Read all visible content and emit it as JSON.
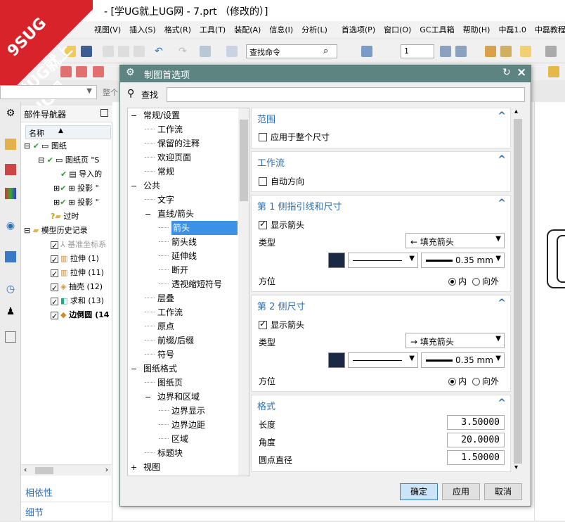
{
  "window": {
    "title": "- [学UG就上UG网 - 7.prt （修改的）]"
  },
  "logo": {
    "line1": "9SUG",
    "line2": "学UG就上UG网"
  },
  "menu": [
    "视图(V)",
    "插入(S)",
    "格式(R)",
    "工具(T)",
    "装配(A)",
    "信息(I)",
    "分析(L)",
    "首选项(P)",
    "窗口(O)",
    "GC工具箱",
    "帮助(H)",
    "中磊1.0",
    "中磊教程"
  ],
  "toolbar": {
    "find_command": "查找命令",
    "layer_value": "1"
  },
  "filter": {
    "value": "整个"
  },
  "navigator": {
    "title": "部件导航器",
    "column": "名称",
    "rows": [
      {
        "label": "图纸"
      },
      {
        "label": "图纸页 \"S"
      },
      {
        "label": "导入的"
      },
      {
        "label": "投影 \""
      },
      {
        "label": "投影 \""
      },
      {
        "label": "过时"
      },
      {
        "label": "模型历史记录"
      },
      {
        "label": "基准坐标系"
      },
      {
        "label": "拉伸 (1)"
      },
      {
        "label": "拉伸 (11)"
      },
      {
        "label": "抽壳 (12)"
      },
      {
        "label": "求和 (13)"
      },
      {
        "label": "边倒圆 (14"
      }
    ],
    "links": [
      "相依性",
      "细节"
    ]
  },
  "dialog": {
    "title": "制图首选项",
    "find_label": "查找",
    "tree": [
      {
        "label": "常规/设置",
        "level": 0,
        "expander": "−"
      },
      {
        "label": "工作流",
        "level": 1
      },
      {
        "label": "保留的注释",
        "level": 1
      },
      {
        "label": "欢迎页面",
        "level": 1
      },
      {
        "label": "常规",
        "level": 1
      },
      {
        "label": "公共",
        "level": 0,
        "expander": "−"
      },
      {
        "label": "文字",
        "level": 1
      },
      {
        "label": "直线/箭头",
        "level": 1,
        "expander": "−"
      },
      {
        "label": "箭头",
        "level": 2,
        "selected": true
      },
      {
        "label": "箭头线",
        "level": 2
      },
      {
        "label": "延伸线",
        "level": 2
      },
      {
        "label": "断开",
        "level": 2
      },
      {
        "label": "透视缩短符号",
        "level": 2
      },
      {
        "label": "层叠",
        "level": 1
      },
      {
        "label": "工作流",
        "level": 1
      },
      {
        "label": "原点",
        "level": 1
      },
      {
        "label": "前缀/后缀",
        "level": 1
      },
      {
        "label": "符号",
        "level": 1
      },
      {
        "label": "图纸格式",
        "level": 0,
        "expander": "−"
      },
      {
        "label": "图纸页",
        "level": 1
      },
      {
        "label": "边界和区域",
        "level": 1,
        "expander": "−"
      },
      {
        "label": "边界显示",
        "level": 2
      },
      {
        "label": "边界边距",
        "level": 2
      },
      {
        "label": "区域",
        "level": 2
      },
      {
        "label": "标题块",
        "level": 1
      },
      {
        "label": "视图",
        "level": 0,
        "expander": "+"
      }
    ],
    "sections": {
      "scope": {
        "title": "范围",
        "apply_all": "应用于整个尺寸"
      },
      "workflow": {
        "title": "工作流",
        "auto_dir": "自动方向"
      },
      "side1": {
        "title": "第 1 侧指引线和尺寸",
        "show_arrow": "显示箭头",
        "type_label": "类型",
        "type_value": "填充箭头",
        "type_glyph": "←",
        "width_value": "0.35 mm",
        "dir_label": "方位",
        "dir_in": "内",
        "dir_out": "向外"
      },
      "side2": {
        "title": "第 2 侧尺寸",
        "show_arrow": "显示箭头",
        "type_label": "类型",
        "type_value": "填充箭头",
        "type_glyph": "→",
        "width_value": "0.35 mm",
        "dir_label": "方位",
        "dir_in": "内",
        "dir_out": "向外"
      },
      "format": {
        "title": "格式",
        "length_label": "长度",
        "length_value": "3.50000",
        "angle_label": "角度",
        "angle_value": "20.0000",
        "dot_label": "圆点直径",
        "dot_value": "1.50000"
      }
    },
    "buttons": {
      "ok": "确定",
      "apply": "应用",
      "cancel": "取消"
    }
  },
  "colors": {
    "arrow_color": "#1b2a44",
    "dialog_title": "#5d8481",
    "accent": "#2c6fb5"
  }
}
